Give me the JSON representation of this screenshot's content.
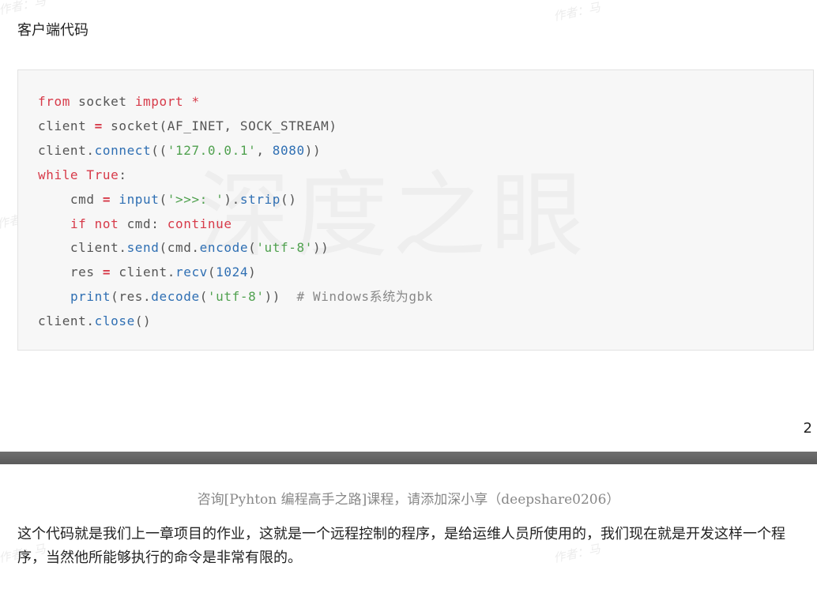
{
  "watermarks": {
    "small": [
      "作者：马",
      "作者：马",
      "作者",
      "作者：马",
      "作者：马"
    ],
    "big": "深度之眼"
  },
  "heading": "客户端代码",
  "code": {
    "language": "python",
    "lines": [
      "from socket import *",
      "client = socket(AF_INET, SOCK_STREAM)",
      "client.connect(('127.0.0.1', 8080))",
      "while True:",
      "    cmd = input('>>>: ').strip()",
      "    if not cmd: continue",
      "    client.send(cmd.encode('utf-8'))",
      "    res = client.recv(1024)",
      "    print(res.decode('utf-8'))  # Windows系统为gbk",
      "client.close()"
    ]
  },
  "page_number": "2",
  "header_note": "咨询[Pyhton 编程高手之路]课程，请添加深小享（deepshare0206）",
  "paragraph": "这个代码就是我们上一章项目的作业，这就是一个远程控制的程序，是给运维人员所使用的，我们现在就是开发这样一个程序，当然他所能够执行的命令是非常有限的。",
  "colors": {
    "keyword": "#d73a49",
    "function": "#2f6fb3",
    "string": "#50a14f",
    "number": "#2f6fb3",
    "comment": "#888888",
    "code_background": "#f7f7f7",
    "separator": "#666666"
  }
}
